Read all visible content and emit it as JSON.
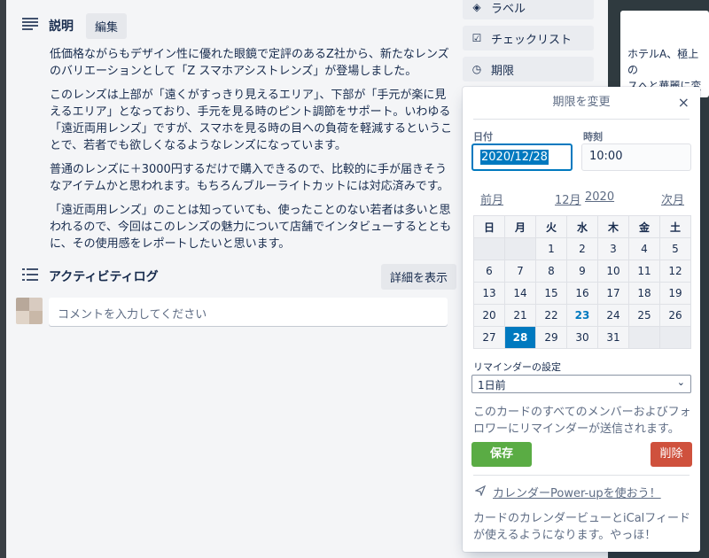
{
  "description": {
    "title": "説明",
    "edit_label": "編集",
    "paragraphs": [
      "低価格ながらもデザイン性に優れた眼鏡で定評のあるZ社から、新たなレンズのバリエーションとして「Z スマホアシストレンズ」が登場しました。",
      "このレンズは上部が「遠くがすっきり見えるエリア」、下部が「手元が楽に見えるエリア」となっており、手元を見る時のピント調節をサポート。いわゆる「遠近両用レンズ」ですが、スマホを見る時の目への負荷を軽減するということで、若者でも欲しくなるようなレンズになっています。",
      "普通のレンズに＋3000円するだけで購入できるので、比較的に手が届きそうなアイテムかと思われます。もちろんブルーライトカットには対応済みです。",
      "「遠近両用レンズ」のことは知っていても、使ったことのない若者は多いと思われるので、今回はこのレンズの魅力について店舗でインタビューするとともに、その使用感をレポートしたいと思います。"
    ]
  },
  "activity": {
    "title": "アクティビティログ",
    "details_label": "詳細を表示",
    "comment_placeholder": "コメントを入力してください"
  },
  "sidebar": {
    "label": "ラベル",
    "checklist": "チェックリスト",
    "due": "期限"
  },
  "right_card": {
    "line1": "ホテルA、極上の",
    "line2": "スへと華麗に変身"
  },
  "popup": {
    "title": "期限を変更",
    "close": "×",
    "date_label": "日付",
    "time_label": "時刻",
    "date_value": "2020/12/28",
    "time_value": "10:00",
    "prev": "前月",
    "month": "12月",
    "year": "2020",
    "next": "次月",
    "weekdays": [
      "日",
      "月",
      "火",
      "水",
      "木",
      "金",
      "土"
    ],
    "weeks": [
      [
        "",
        "",
        "1",
        "2",
        "3",
        "4",
        "5"
      ],
      [
        "6",
        "7",
        "8",
        "9",
        "10",
        "11",
        "12"
      ],
      [
        "13",
        "14",
        "15",
        "16",
        "17",
        "18",
        "19"
      ],
      [
        "20",
        "21",
        "22",
        "23",
        "24",
        "25",
        "26"
      ],
      [
        "27",
        "28",
        "29",
        "30",
        "31",
        "",
        ""
      ]
    ],
    "today": "23",
    "selected": "28",
    "reminder_label": "リマインダーの設定",
    "reminder_value": "1日前",
    "reminder_note": "このカードのすべてのメンバーおよびフォロワーにリマインダーが送信されます。",
    "save": "保存",
    "delete": "削除",
    "powerup": "カレンダーPower-upを使おう！",
    "powerup_note": "カードのカレンダービューとiCalフィードが使えるようになります。やっほ！"
  },
  "colors": {
    "accent": "#0079bf",
    "save": "#5aac44",
    "delete": "#cf513d"
  }
}
